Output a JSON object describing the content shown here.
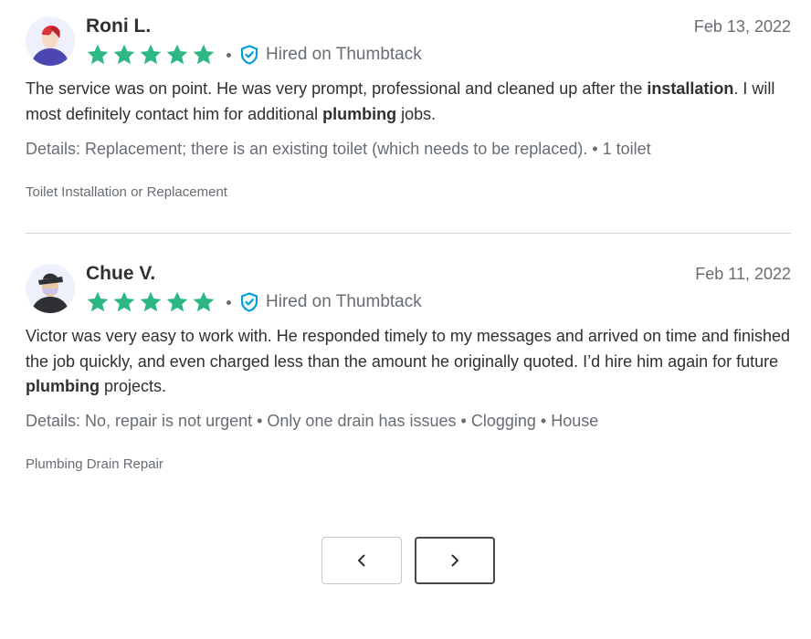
{
  "colors": {
    "star": "#2db783",
    "shield": "#009fd9",
    "text_primary": "#2f3033",
    "text_secondary": "#676d73",
    "divider": "#d3d4d5"
  },
  "reviews": [
    {
      "name": "Roni L.",
      "date": "Feb 13, 2022",
      "rating": 5,
      "hired_label": "Hired on Thumbtack",
      "avatar_icon": "person-avatar-icon",
      "text_parts": [
        "The service was on point. He was very prompt, professional and cleaned up after the ",
        "installation",
        ". I will most definitely contact him for additional ",
        "plumbing",
        " jobs."
      ],
      "details": "Details: Replacement; there is an existing toilet (which needs to be replaced). • 1 toilet",
      "category": "Toilet Installation or Replacement"
    },
    {
      "name": "Chue V.",
      "date": "Feb 11, 2022",
      "rating": 5,
      "hired_label": "Hired on Thumbtack",
      "avatar_icon": "person-avatar-icon",
      "text_parts": [
        "Victor was very easy to work with. He responded timely to my messages and arrived on time and finished the job quickly, and even charged less than the amount he originally quoted. I’d hire him again for future ",
        "plumbing",
        " projects."
      ],
      "details": "Details: No, repair is not urgent • Only one drain has issues • Clogging • House",
      "category": "Plumbing Drain Repair"
    }
  ],
  "pagination": {
    "prev_icon": "chevron-left-icon",
    "next_icon": "chevron-right-icon"
  }
}
